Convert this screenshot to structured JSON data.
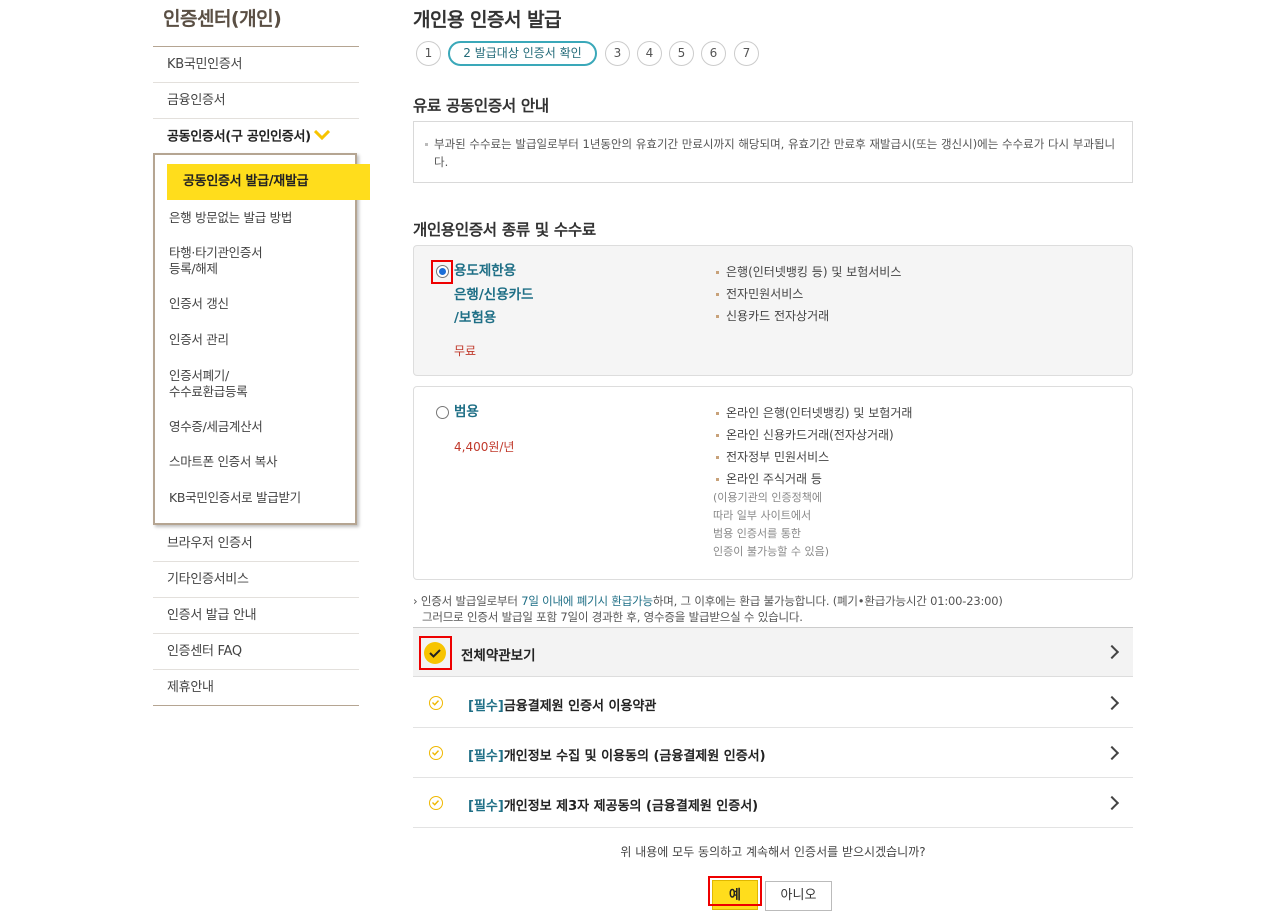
{
  "sidebar": {
    "title": "인증센터(개인)",
    "items_top": [
      "KB국민인증서",
      "금융인증서"
    ],
    "active": "공동인증서(구 공인인증서)",
    "submenu": [
      "공동인증서 발급/재발급",
      "은행 방문없는 발급 방법",
      "타행·타기관인증서\n등록/해제",
      "인증서 갱신",
      "인증서 관리",
      "인증서폐기/\n수수료환급등록",
      "영수증/세금계산서",
      "스마트폰 인증서 복사",
      "KB국민인증서로 발급받기"
    ],
    "items_bottom": [
      "브라우저 인증서",
      "기타인증서비스",
      "인증서 발급 안내",
      "인증센터 FAQ",
      "제휴안내"
    ]
  },
  "main": {
    "title": "개인용 인증서 발급",
    "steps": [
      "1",
      "2 발급대상 인증서 확인",
      "3",
      "4",
      "5",
      "6",
      "7"
    ],
    "notice_title": "유료 공동인증서 안내",
    "notice_text": "부과된 수수료는 발급일로부터 1년동안의 유효기간 만료시까지 해당되며, 유효기간 만료후 재발급시(또는 갱신시)에는 수수료가 다시 부과됩니다.",
    "fee_title": "개인용인증서 종류 및 수수료",
    "plans": [
      {
        "name_lines": [
          "용도제한용",
          "은행/신용카드",
          "/보험용"
        ],
        "price": "무료",
        "features": [
          "은행(인터넷뱅킹 등) 및 보험서비스",
          "전자민원서비스",
          "신용카드 전자상거래"
        ]
      },
      {
        "name_lines": [
          "범용"
        ],
        "price": "4,400원/년",
        "features": [
          "온라인 은행(인터넷뱅킹) 및 보험거래",
          "온라인 신용카드거래(전자상거래)",
          "전자정부 민원서비스",
          "온라인 주식거래 등"
        ],
        "note_lines": [
          "(이용기관의 인증정책에",
          "따라 일부 사이트에서",
          "범용 인증서를 통한",
          "인증이 불가능할 수 있음)"
        ]
      }
    ],
    "refund": {
      "pre": "인증서 발급일로부터 ",
      "hl": "7일 이내에 폐기시 환급가능",
      "post": "하며, 그 이후에는 환급 불가능합니다. (폐기•환급가능시간 01:00-23:00)",
      "line2": "그러므로 인증서 발급일 포함 7일이 경과한 후, 영수증을 발급받으실 수 있습니다."
    },
    "all_agree": "전체약관보기",
    "agreements": [
      {
        "req": "[필수]",
        "text": "금융결제원 인증서 이용약관"
      },
      {
        "req": "[필수]",
        "text": "개인정보 수집 및 이용동의 (금융결제원 인증서)"
      },
      {
        "req": "[필수]",
        "text": "개인정보 제3자 제공동의 (금융결제원 인증서)"
      }
    ],
    "question": "위 내용에 모두 동의하고 계속해서 인증서를 받으시겠습니까?",
    "yes": "예",
    "no": "아니오"
  },
  "colors": {
    "accent_yellow": "#ffdd1c",
    "teal": "#1f6f86",
    "price_red": "#c0392b",
    "highlight_red": "#e00000"
  }
}
